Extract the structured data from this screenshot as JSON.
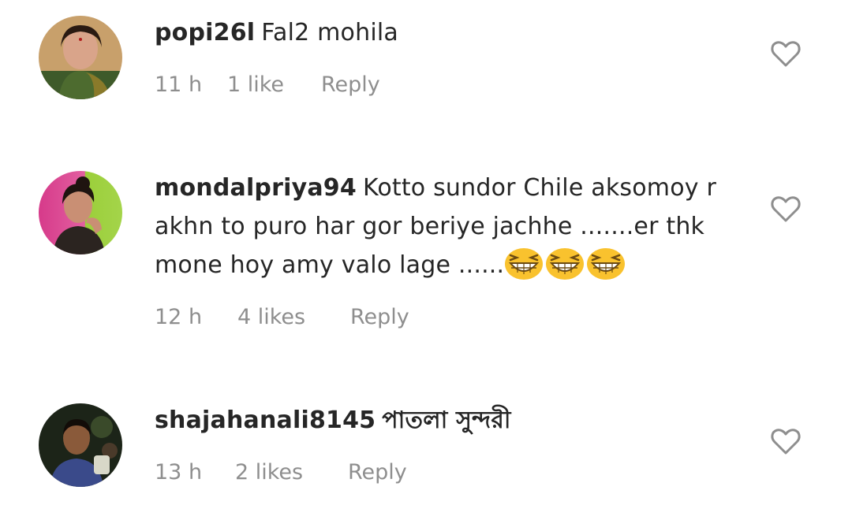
{
  "comments": [
    {
      "username": "popi26l",
      "text": "Fal2 mohila",
      "time": "11 h",
      "likes": "1 like",
      "reply_label": "Reply"
    },
    {
      "username": "mondalpriya94",
      "text": "Kotto  sundor Chile aksomoy r akhn to puro har gor beriye jachhe .......er thk mone hoy amy valo lage ......",
      "emoji": [
        "grinning-squinting-face",
        "grinning-squinting-face",
        "grinning-squinting-face"
      ],
      "time": "12 h",
      "likes": "4 likes",
      "reply_label": "Reply"
    },
    {
      "username": "shajahanali8145",
      "text": "পাতলা সুন্দরী",
      "time": "13 h",
      "likes": "2 likes",
      "reply_label": "Reply"
    }
  ],
  "icons": {
    "like": "heart-outline-icon"
  },
  "colors": {
    "text": "#262626",
    "meta": "#8e8e8e",
    "icon": "#8e8e8e",
    "emoji": "#f9c22e"
  }
}
